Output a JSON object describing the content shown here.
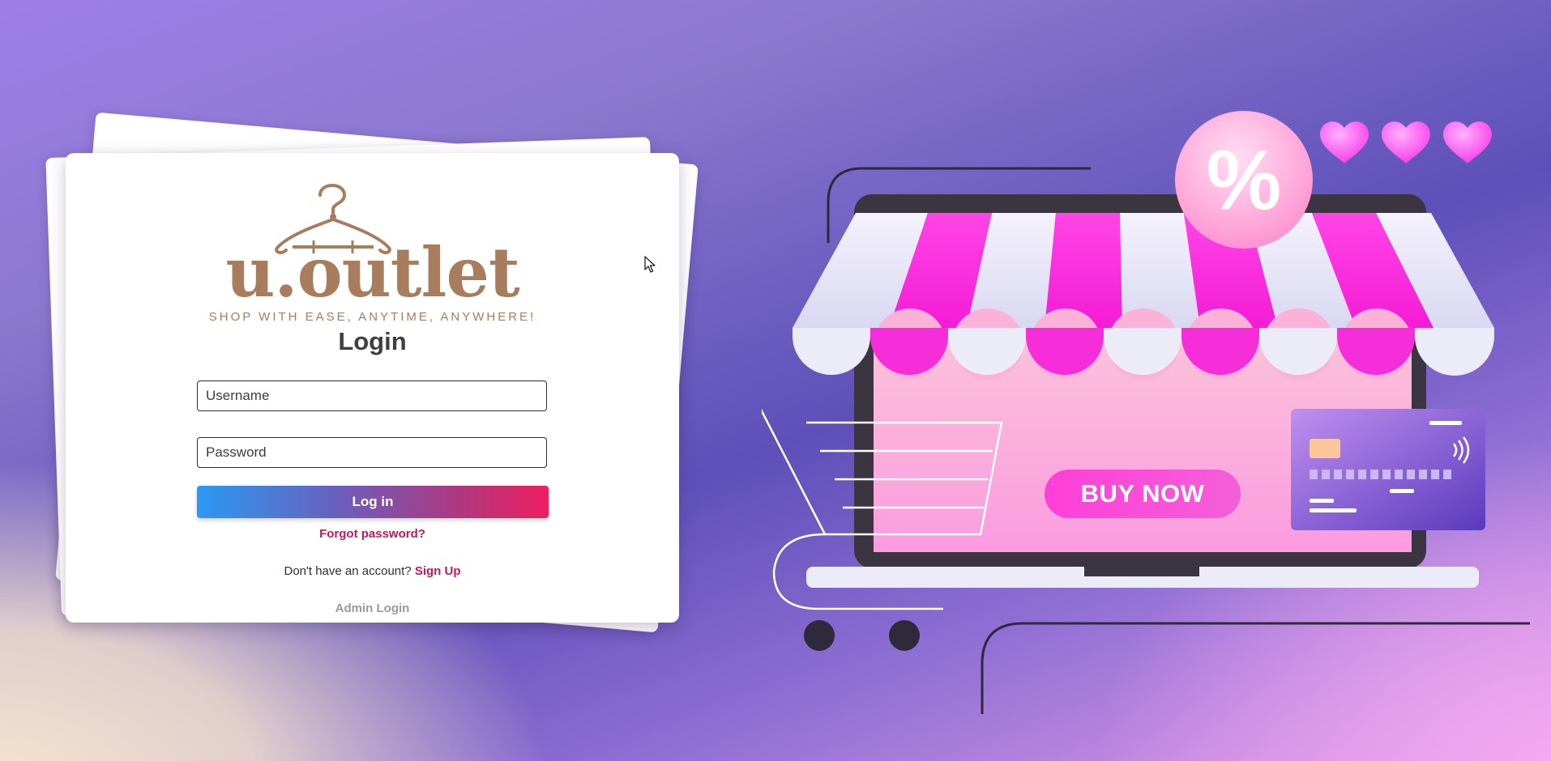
{
  "brand": {
    "name": "u.outlet",
    "tagline": "SHOP WITH EASE, ANYTIME, ANYWHERE!"
  },
  "login": {
    "title": "Login",
    "username_placeholder": "Username",
    "password_placeholder": "Password",
    "submit_label": "Log in",
    "forgot_label": "Forgot password?",
    "signup_prompt": "Don't have an account?",
    "signup_link": "Sign Up",
    "admin_link": "Admin Login"
  },
  "illustration": {
    "buy_label": "BUY NOW",
    "discount_symbol": "%",
    "icons": [
      "heart-icon",
      "heart-icon",
      "heart-icon",
      "percent-badge-icon",
      "credit-card-icon",
      "shopping-cart-icon",
      "storefront-awning-icon",
      "laptop-icon"
    ]
  },
  "colors": {
    "brand_brown": "#a87d5d",
    "accent_pink": "#c2185b",
    "button_gradient_start": "#2a9af3",
    "button_gradient_end": "#ee1f60",
    "magenta": "#ff2fe0"
  }
}
